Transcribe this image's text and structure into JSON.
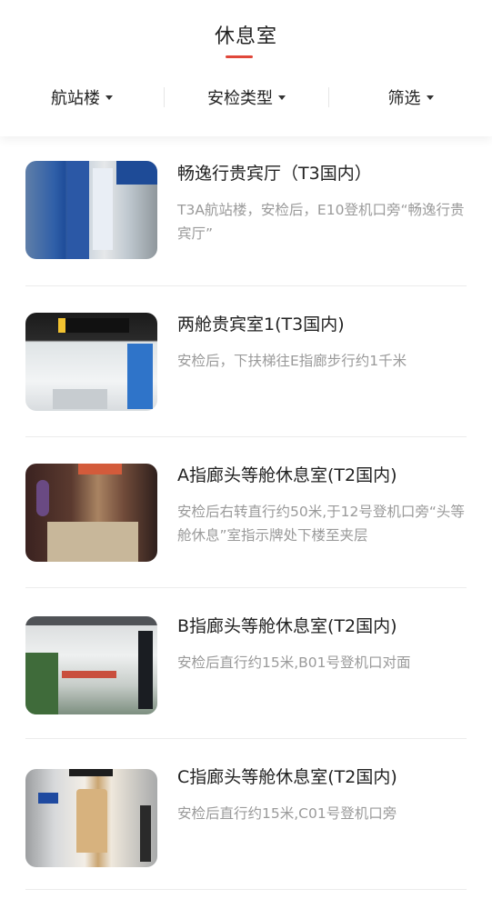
{
  "header": {
    "title": "休息室"
  },
  "filters": [
    {
      "label": "航站楼"
    },
    {
      "label": "安检类型"
    },
    {
      "label": "筛选"
    }
  ],
  "lounges": [
    {
      "name": "畅逸行贵宾厅（T3国内）",
      "description": "T3A航站楼，安检后，E10登机口旁“畅逸行贵宾厅”"
    },
    {
      "name": "两舱贵宾室1(T3国内)",
      "description": "安检后，下扶梯往E指廊步行约1千米"
    },
    {
      "name": "A指廊头等舱休息室(T2国内)",
      "description": "安检后右转直行约50米,于12号登机口旁“头等舱休息”室指示牌处下楼至夹层"
    },
    {
      "name": "B指廊头等舱休息室(T2国内)",
      "description": "安检后直行约15米,B01号登机口对面"
    },
    {
      "name": "C指廊头等舱休息室(T2国内)",
      "description": "安检后直行约15米,C01号登机口旁"
    }
  ]
}
